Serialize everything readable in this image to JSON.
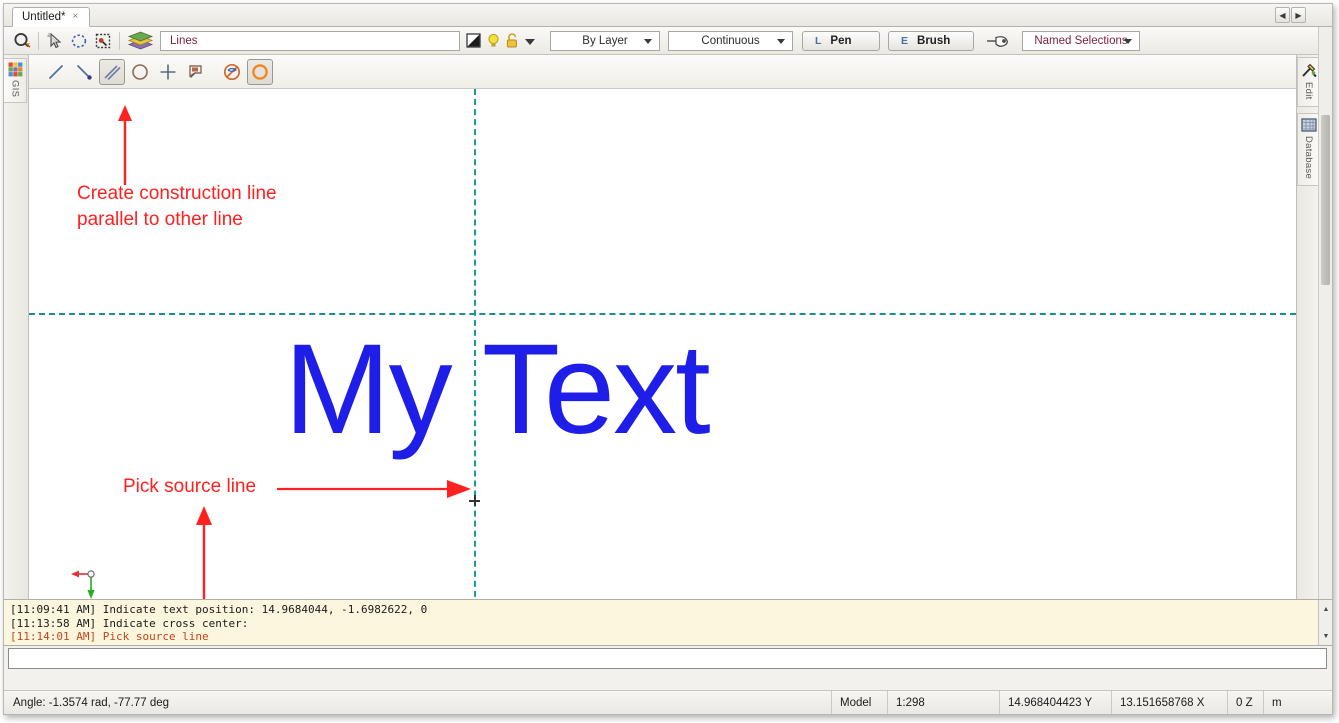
{
  "window": {
    "tab": {
      "title": "Untitled*",
      "close": "×"
    },
    "tab_nav": {
      "prev": "◀",
      "next": "▶"
    }
  },
  "toolbar": {
    "icons": [
      "snap-settings-icon",
      "pointer-select-icon",
      "lasso-select-icon",
      "window-select-icon",
      "layers-icon"
    ],
    "layer_name": "Lines",
    "property_icons": [
      "layer-color-icon",
      "layer-visibility-icon",
      "layer-lock-icon",
      "layer-dropdown-icon"
    ],
    "color_combo": {
      "value": "By Layer",
      "options": [
        "By Layer"
      ]
    },
    "linetype_combo": {
      "value": "Continuous",
      "options": [
        "Continuous"
      ]
    },
    "pen_button": {
      "key": "L",
      "label": "Pen"
    },
    "brush_button": {
      "key": "E",
      "label": "Brush"
    },
    "pointer_icon": "hand-pointer-icon",
    "named_selections": {
      "value": "Named Selections",
      "options": [
        "Named Selections"
      ]
    }
  },
  "drawbar": {
    "tools": [
      {
        "name": "line-tool",
        "selected": false
      },
      {
        "name": "line-with-point-tool",
        "selected": false
      },
      {
        "name": "parallel-construction-line-tool",
        "selected": true
      },
      {
        "name": "circle-tool",
        "selected": false
      },
      {
        "name": "cross-point-tool",
        "selected": false
      },
      {
        "name": "tag-label-tool",
        "selected": false
      },
      {
        "name": "delete-construction-tool",
        "selected": false
      },
      {
        "name": "construction-circle-tool",
        "selected": true
      }
    ]
  },
  "left_dock": {
    "tabs": [
      {
        "label": "GIS",
        "icon": "gis-grid-icon"
      }
    ]
  },
  "right_dock": {
    "tabs": [
      {
        "label": "Edit",
        "icon": "hammer-wrench-icon"
      },
      {
        "label": "Database",
        "icon": "database-grid-icon"
      }
    ]
  },
  "canvas": {
    "text_entity": "My Text",
    "text_color": "#1e1ee8",
    "construction_line_color": "#1b9b9b",
    "annotations": [
      {
        "name": "annotation-create-construction-line",
        "line1": "Create construction line",
        "line2": "parallel to other line",
        "color": "#ff2020"
      },
      {
        "name": "annotation-pick-source-line",
        "line1": "Pick source line",
        "color": "#ff2020"
      }
    ],
    "origin_marker": {
      "x_axis_color": "#e03030",
      "y_axis_color": "#20b020"
    }
  },
  "console": {
    "lines": [
      {
        "text": "[11:09:41 AM] Indicate text position: 14.9684044, -1.6982622, 0",
        "accent": false
      },
      {
        "text": "[11:13:58 AM] Indicate cross center:",
        "accent": false
      },
      {
        "text": "[11:14:01 AM] Pick source line",
        "accent": true
      }
    ],
    "scroll_up": "▲",
    "scroll_down": "▼",
    "command_input_value": "",
    "command_input_placeholder": ""
  },
  "statusbar": {
    "angle": "Angle: -1.3574 rad, -77.77 deg",
    "model": "Model",
    "scale": "1:298",
    "coord_y": "14.968404423 Y",
    "coord_x": "13.151658768 X",
    "coord_z": "0 Z",
    "units": "m"
  }
}
